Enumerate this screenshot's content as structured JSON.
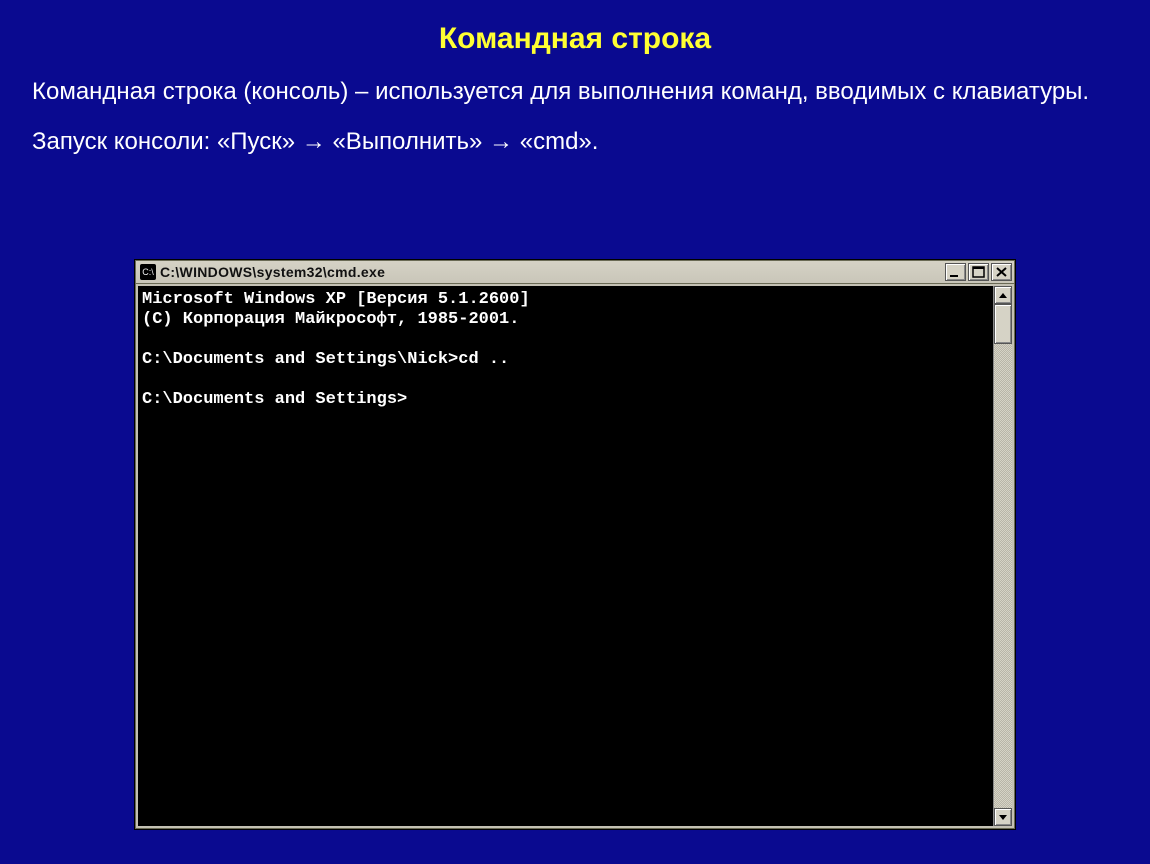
{
  "slide": {
    "title": "Командная строка",
    "paragraph1": "Командная строка (консоль) – используется для выполнения команд, вводимых с клавиатуры.",
    "paragraph2": "Запуск консоли: «Пуск» → «Выполнить» → «cmd»."
  },
  "cmd": {
    "title": "C:\\WINDOWS\\system32\\cmd.exe",
    "icon_text": "C:\\",
    "content": "Microsoft Windows XP [Версия 5.1.2600]\n(С) Корпорация Майкрософт, 1985-2001.\n\nC:\\Documents and Settings\\Nick>cd ..\n\nC:\\Documents and Settings>"
  }
}
